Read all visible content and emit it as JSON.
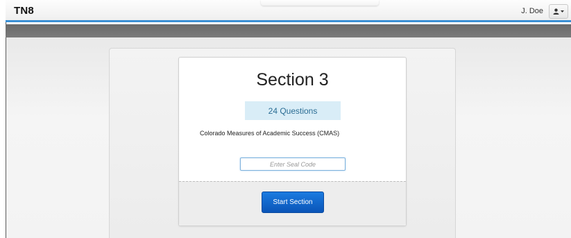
{
  "header": {
    "brand": "TN8",
    "username": "J. Doe",
    "user_menu_icon": "user-icon",
    "caret_icon": "caret-down-icon"
  },
  "section": {
    "title": "Section 3",
    "questions_badge": "24 Questions",
    "test_name": "Colorado Measures of Academic Success (CMAS)",
    "seal_code_placeholder": "Enter Seal Code",
    "seal_code_value": "",
    "start_button_label": "Start Section"
  },
  "colors": {
    "accent_blue": "#3a8fd4",
    "button_blue": "#0a55b8",
    "badge_bg": "#d9edf7",
    "badge_text": "#2b6d94",
    "band_grey": "#707070"
  }
}
